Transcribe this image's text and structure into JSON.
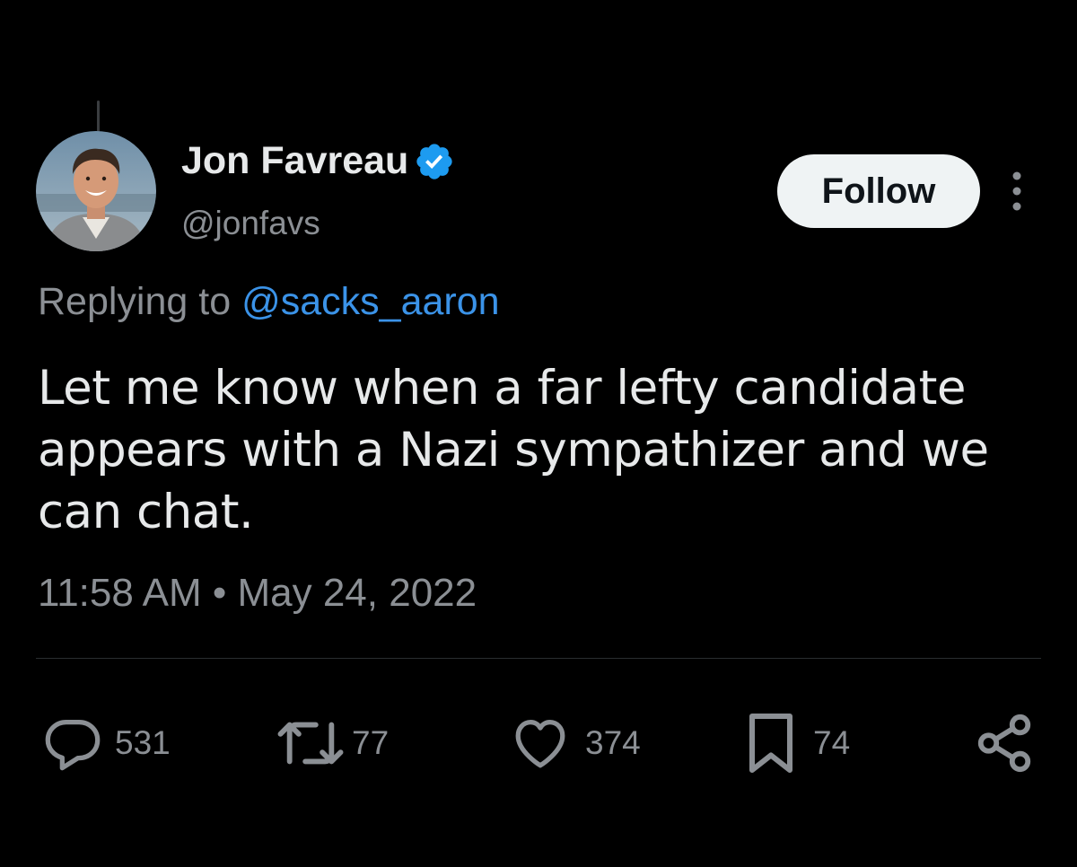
{
  "tweet": {
    "author": {
      "name": "Jon Favreau",
      "handle": "@jonfavs",
      "verified": true,
      "avatar_icon": "profile-photo"
    },
    "follow_label": "Follow",
    "more_icon": "more-vertical-icon",
    "replying_to": {
      "prefix": "Replying to",
      "handle": "@sacks_aaron"
    },
    "text": "Let me know when a far lefty candidate appears with a Nazi sympathizer and we can chat.",
    "timestamp": "11:58 AM • May 24, 2022",
    "actions": {
      "replies": {
        "icon": "reply-icon",
        "count": "531"
      },
      "reposts": {
        "icon": "repost-icon",
        "count": "77"
      },
      "likes": {
        "icon": "heart-icon",
        "count": "374"
      },
      "bookmarks": {
        "icon": "bookmark-icon",
        "count": "74"
      },
      "share": {
        "icon": "share-icon"
      }
    }
  },
  "colors": {
    "background": "#000000",
    "primary_text": "#e7e9ea",
    "secondary_text": "#8b8f94",
    "link": "#3b93e8",
    "verified_badge": "#1d9bf0",
    "follow_button_bg": "#eff3f4",
    "follow_button_text": "#0f1419"
  }
}
